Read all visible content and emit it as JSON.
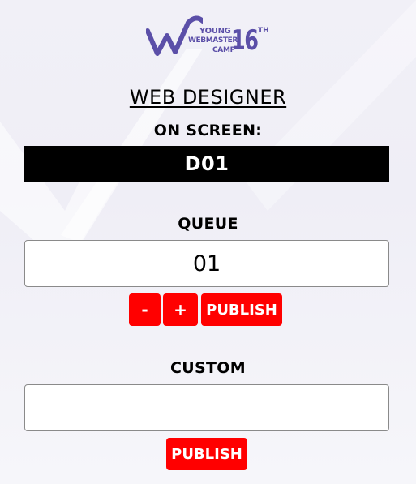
{
  "logo": {
    "line1": "YOUNG",
    "line2": "WEBMASTER",
    "line3": "CAMP",
    "edition_number": "16",
    "edition_suffix": "TH",
    "brand_color": "#5b4fa8"
  },
  "role": {
    "title": "WEB DESIGNER"
  },
  "on_screen": {
    "label": "ON SCREEN:",
    "value": "D01"
  },
  "queue": {
    "label": "QUEUE",
    "value": "01",
    "decrement_label": "-",
    "increment_label": "+",
    "publish_label": "PUBLISH"
  },
  "custom": {
    "label": "CUSTOM",
    "value": "",
    "publish_label": "PUBLISH"
  },
  "colors": {
    "accent": "#ff0000",
    "screen_background": "#000000",
    "screen_text": "#ffffff"
  }
}
